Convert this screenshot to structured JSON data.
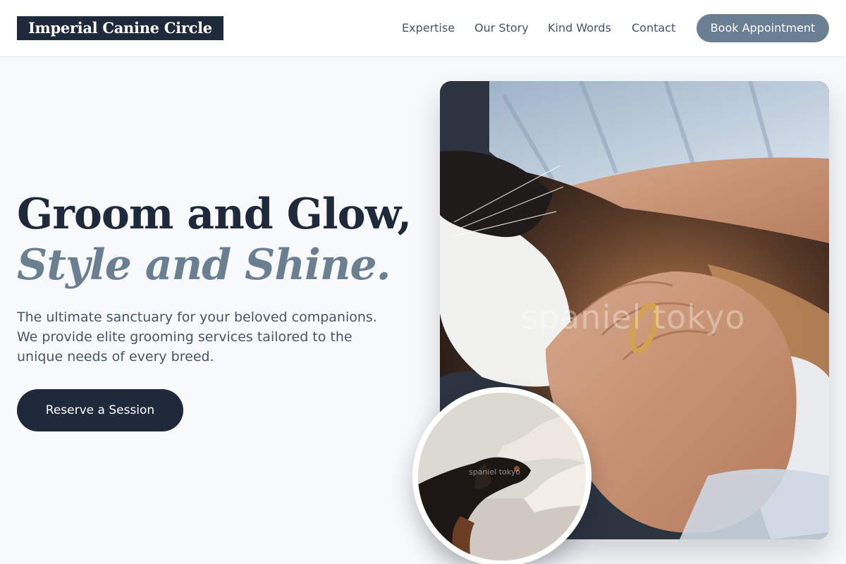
{
  "header": {
    "logo": "Imperial Canine Circle",
    "nav": [
      "Expertise",
      "Our Story",
      "Kind Words",
      "Contact"
    ],
    "cta": "Book Appointment"
  },
  "hero": {
    "headline_line1": "Groom and Glow,",
    "headline_line2": "Style and Shine.",
    "description": "The ultimate sanctuary for your beloved companions. We provide elite grooming services tailored to the unique needs of every breed.",
    "cta": "Reserve a Session"
  },
  "images": {
    "main_watermark": "spaniel tokyo",
    "circle_watermark": "spaniel tokyo"
  },
  "colors": {
    "navy": "#1e293b",
    "slate_accent": "#6b7f93",
    "text_muted": "#475569",
    "background": "#f8f9fb"
  }
}
